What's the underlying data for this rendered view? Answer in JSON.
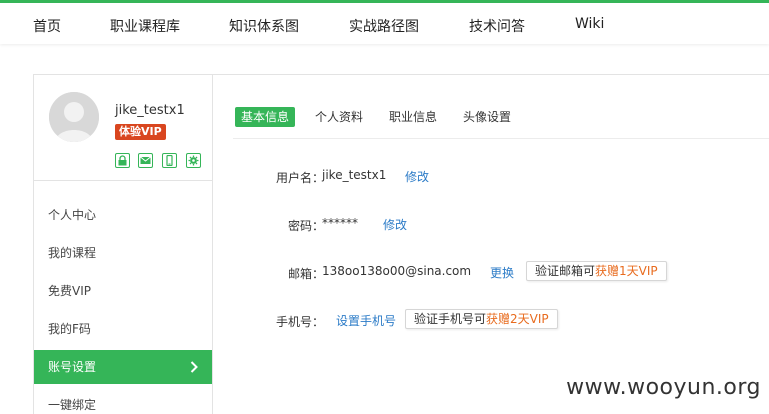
{
  "nav": {
    "items": [
      {
        "label": "首页"
      },
      {
        "label": "职业课程库"
      },
      {
        "label": "知识体系图"
      },
      {
        "label": "实战路径图"
      },
      {
        "label": "技术问答"
      },
      {
        "label": "Wiki"
      }
    ]
  },
  "profile": {
    "username": "jike_testx1",
    "vip_badge": "体验VIP",
    "bind_icons": [
      "lock-icon",
      "mail-icon",
      "phone-icon",
      "gear-icon"
    ],
    "accent": "#35b558",
    "badge_color": "#d9461f"
  },
  "sidebar": {
    "items": [
      {
        "label": "个人中心"
      },
      {
        "label": "我的课程"
      },
      {
        "label": "免费VIP"
      },
      {
        "label": "我的F码"
      },
      {
        "label": "账号设置"
      },
      {
        "label": "一键绑定"
      }
    ],
    "active": "账号设置"
  },
  "tabs": {
    "items": [
      {
        "label": "基本信息"
      },
      {
        "label": "个人资料"
      },
      {
        "label": "职业信息"
      },
      {
        "label": "头像设置"
      }
    ],
    "active": "基本信息"
  },
  "form": {
    "username": {
      "label": "用户名：",
      "value": "jike_testx1",
      "action": "修改"
    },
    "password": {
      "label": "密码：",
      "value": "******",
      "action": "修改"
    },
    "email": {
      "label": "邮箱：",
      "value": "138oo138o00@sina.com",
      "action": "更换",
      "tip_prefix": "验证邮箱可",
      "tip_highlight": "获赠1天VIP"
    },
    "phone": {
      "label": "手机号：",
      "action": "设置手机号",
      "tip_prefix": "验证手机号可",
      "tip_highlight": "获赠2天VIP"
    }
  },
  "watermark": "www.wooyun.org"
}
